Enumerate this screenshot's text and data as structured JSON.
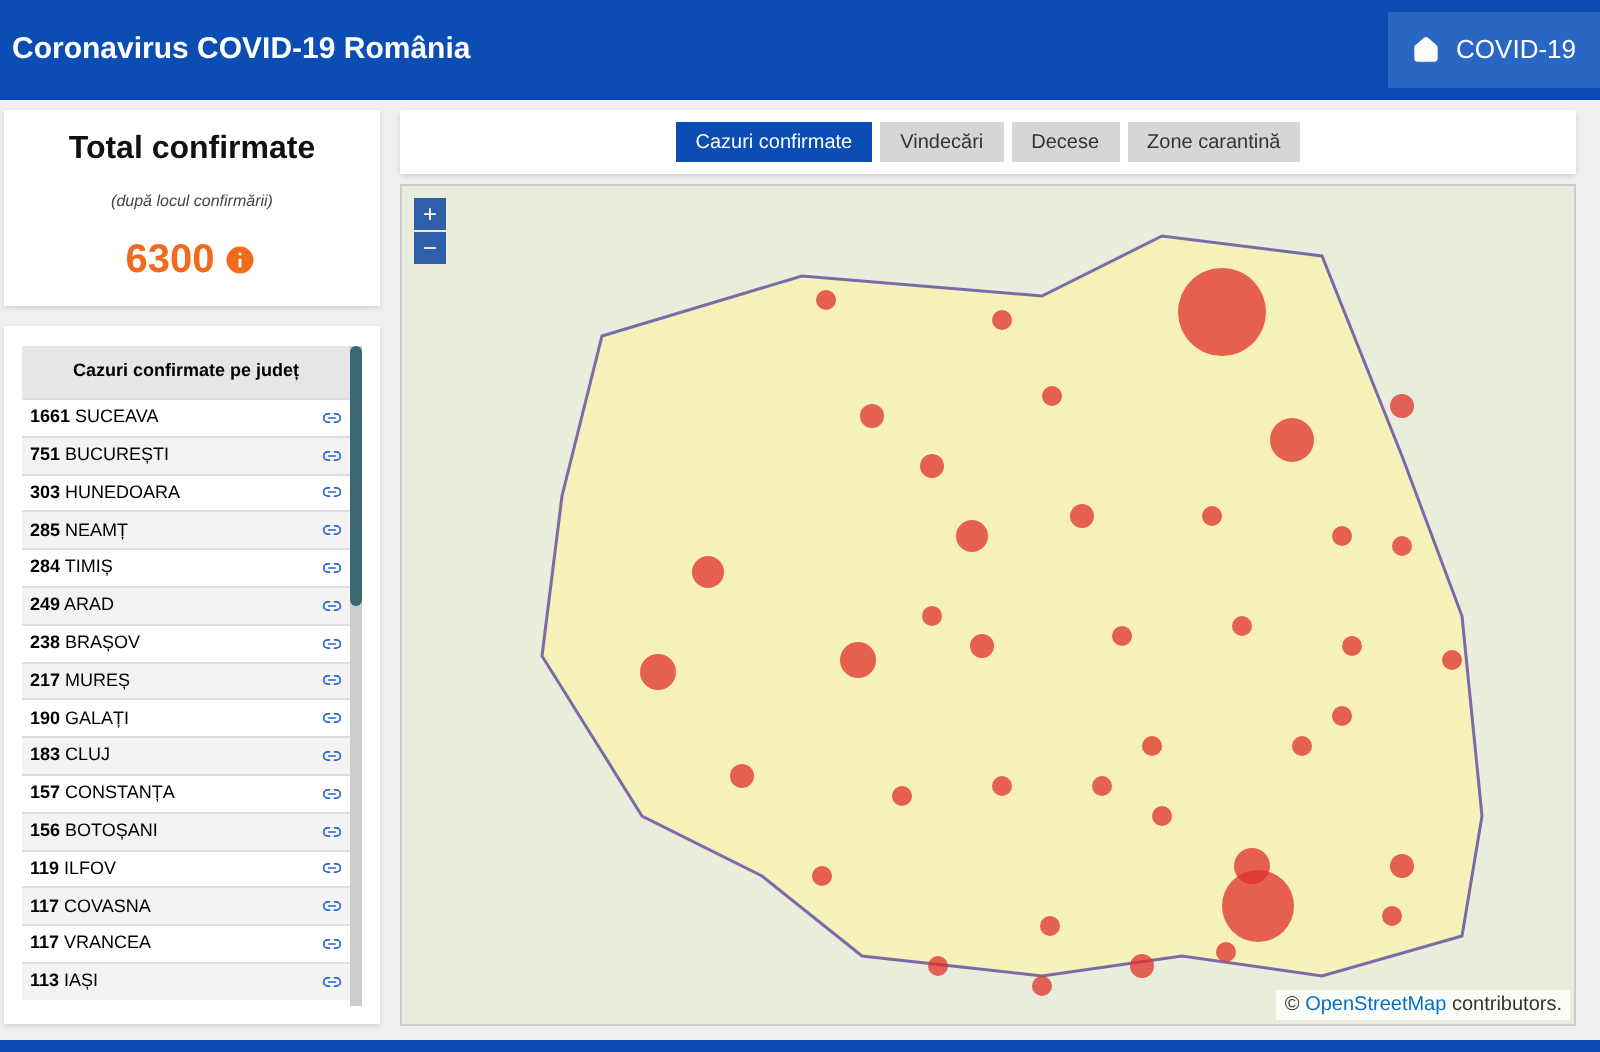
{
  "header": {
    "title": "Coronavirus COVID-19 România",
    "nav_button": "COVID-19"
  },
  "total": {
    "title": "Total confirmate",
    "subtitle": "(după locul confirmării)",
    "value": "6300"
  },
  "table": {
    "heading": "Cazuri confirmate pe județ",
    "rows": [
      {
        "count": "1661",
        "county": "SUCEAVA"
      },
      {
        "count": "751",
        "county": "BUCUREȘTI"
      },
      {
        "count": "303",
        "county": "HUNEDOARA"
      },
      {
        "count": "285",
        "county": "NEAMȚ"
      },
      {
        "count": "284",
        "county": "TIMIȘ"
      },
      {
        "count": "249",
        "county": "ARAD"
      },
      {
        "count": "238",
        "county": "BRAȘOV"
      },
      {
        "count": "217",
        "county": "MUREȘ"
      },
      {
        "count": "190",
        "county": "GALAȚI"
      },
      {
        "count": "183",
        "county": "CLUJ"
      },
      {
        "count": "157",
        "county": "CONSTANȚA"
      },
      {
        "count": "156",
        "county": "BOTOȘANI"
      },
      {
        "count": "119",
        "county": "ILFOV"
      },
      {
        "count": "117",
        "county": "COVASNA"
      },
      {
        "count": "117",
        "county": "VRANCEA"
      },
      {
        "count": "113",
        "county": "IAȘI"
      }
    ]
  },
  "tabs": [
    {
      "label": "Cazuri confirmate",
      "selected": true
    },
    {
      "label": "Vindecări",
      "selected": false
    },
    {
      "label": "Decese",
      "selected": false
    },
    {
      "label": "Zone carantină",
      "selected": false
    }
  ],
  "map": {
    "zoom_in": "+",
    "zoom_out": "−",
    "attribution": {
      "prefix": "©",
      "link": "OpenStreetMap",
      "suffix": "contributors."
    }
  }
}
